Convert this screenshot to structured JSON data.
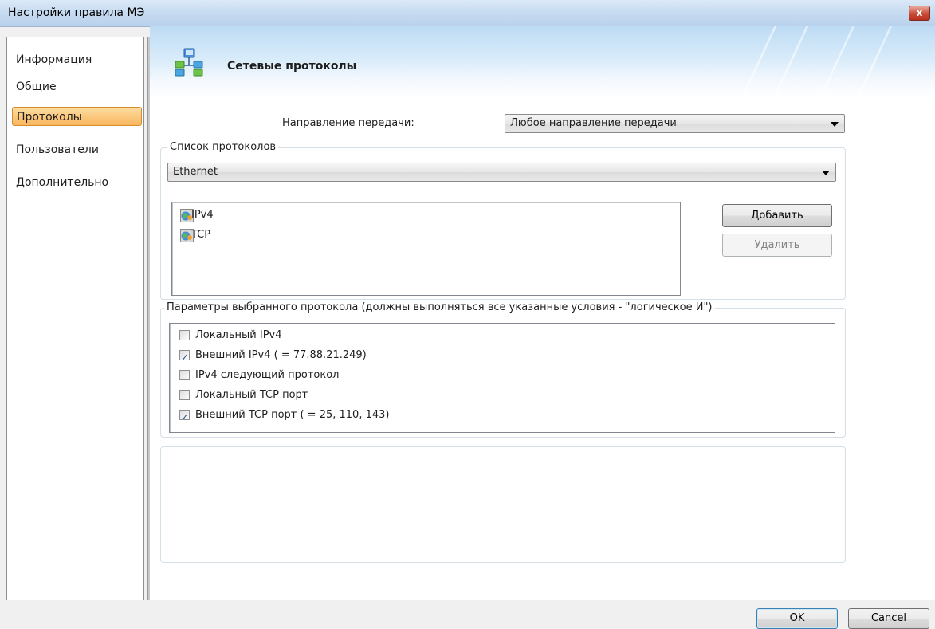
{
  "window": {
    "title": "Настройки правила МЭ",
    "close_label": "x"
  },
  "nav": {
    "items": [
      {
        "label": "Информация",
        "active": false
      },
      {
        "label": "Общие",
        "active": false
      },
      {
        "label": "Протоколы",
        "active": true
      },
      {
        "label": "Пользователи",
        "active": false
      },
      {
        "label": "Дополнительно",
        "active": false
      }
    ]
  },
  "header": {
    "title": "Сетевые протоколы",
    "icon": "network-icon"
  },
  "direction": {
    "label": "Направление передачи:",
    "value": "Любое направление передачи"
  },
  "protocols": {
    "legend": "Список протоколов",
    "layer_value": "Ethernet",
    "items": [
      {
        "label": "IPv4",
        "icon": "protocol-icon"
      },
      {
        "label": "TCP",
        "icon": "protocol-icon"
      }
    ],
    "add_label": "Добавить",
    "remove_label": "Удалить"
  },
  "params": {
    "legend": "Параметры выбранного протокола (должны выполняться все указанные условия - \"логическое И\")",
    "items": [
      {
        "label": "Локальный IPv4",
        "checked": false
      },
      {
        "label": "Внешний IPv4 ( = 77.88.21.249)",
        "checked": true
      },
      {
        "label": "IPv4 следующий протокол",
        "checked": false
      },
      {
        "label": "Локальный TCP порт",
        "checked": false
      },
      {
        "label": "Внешний TCP порт ( = 25, 110, 143)",
        "checked": true
      }
    ]
  },
  "footer": {
    "ok_label": "OK",
    "cancel_label": "Cancel"
  }
}
